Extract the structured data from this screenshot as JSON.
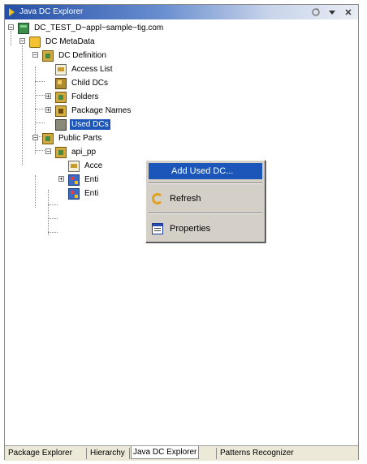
{
  "view": {
    "title": "Java DC Explorer",
    "title_icon": "view-arrow-icon",
    "controls": [
      "sync-icon",
      "view-menu-icon",
      "close-icon"
    ]
  },
  "tree": {
    "project": "DC_TEST_D~appl~sample~tig.com",
    "metadata": "DC MetaData",
    "dc_definition": "DC Definition",
    "access_list": "Access List",
    "child_dcs": "Child DCs",
    "folders": "Folders",
    "package_names": "Package Names",
    "used_dcs": "Used DCs",
    "public_parts": "Public Parts",
    "api_pp": "api_pp",
    "pp_access": "Acce",
    "pp_entities_1": "Enti",
    "pp_entities_2": "Enti"
  },
  "context_menu": {
    "items": [
      {
        "label": "Add Used DC...",
        "highlighted": true
      },
      {
        "label": "Refresh",
        "icon": "refresh-icon"
      },
      {
        "label": "Properties",
        "icon": "properties-icon"
      }
    ]
  },
  "tabs": [
    {
      "label": "Package Explorer"
    },
    {
      "label": "Hierarchy"
    },
    {
      "label": "Java DC Explorer",
      "active": true
    },
    {
      "label": "Patterns Recognizer"
    }
  ],
  "colors": {
    "selection": "#1c56b8",
    "title_gradient_start": "#244fa6",
    "menu_bg": "#d4d0c8"
  }
}
